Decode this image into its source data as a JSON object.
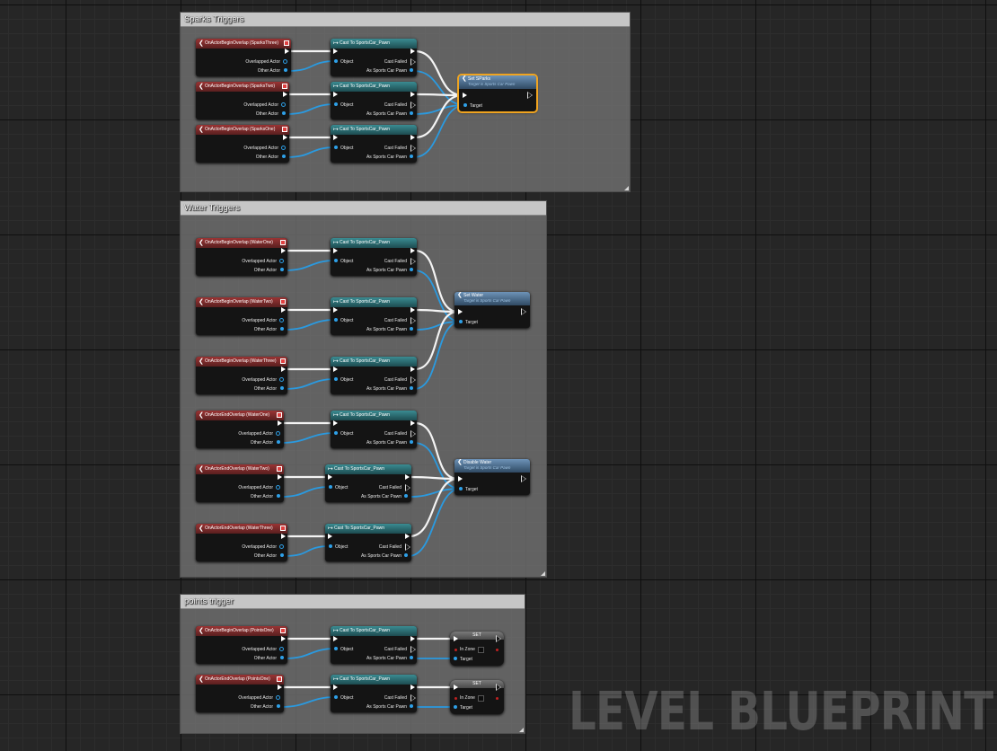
{
  "comments": [
    {
      "title": "Sparks Triggers"
    },
    {
      "title": "Water Triggers"
    },
    {
      "title": "points trigger"
    }
  ],
  "labels": {
    "overlapped_actor": "Overlapped Actor",
    "other_actor": "Other Actor",
    "object": "Object",
    "cast_failed": "Cast Failed",
    "as_sports_car_pawn": "As Sports Car Pawn",
    "target": "Target",
    "in_zone": "In Zone"
  },
  "events": [
    {
      "title": "OnActorBeginOverlap (SparksThree)"
    },
    {
      "title": "OnActorBeginOverlap (SparksTwo)"
    },
    {
      "title": "OnActorBeginOverlap (SparksOne)"
    },
    {
      "title": "OnActorBeginOverlap (WaterOne)"
    },
    {
      "title": "OnActorBeginOverlap (WaterTwo)"
    },
    {
      "title": "OnActorBeginOverlap (WaterThree)"
    },
    {
      "title": "OnActorEndOverlap (WaterOne)"
    },
    {
      "title": "OnActorEndOverlap (WaterTwo)"
    },
    {
      "title": "OnActorEndOverlap (WaterThree)"
    },
    {
      "title": "OnActorBeginOverlap (PointsOne)"
    },
    {
      "title": "OnActorEndOverlap (PointsOne)"
    }
  ],
  "cast_title": "Cast To SportsCar_Pawn",
  "functions": [
    {
      "title": "Set SParks",
      "subtitle": "Target is Sports Car Pawn"
    },
    {
      "title": "Set Water",
      "subtitle": "Target is Sports Car Pawn"
    },
    {
      "title": "Disable Water",
      "subtitle": "Target is Sports Car Pawn"
    }
  ],
  "set_title": "SET",
  "watermark": "LEVEL BLUEPRINT",
  "icons": {
    "event": "event-diamond-icon",
    "cast": "cast-arrow-icon",
    "function": "function-f-icon"
  },
  "colors": {
    "event_header": "#9a3434",
    "cast_header": "#3a8c92",
    "function_header": "#6d93b8",
    "object_pin": "#2ea0e8",
    "selection": "#f0a420"
  }
}
